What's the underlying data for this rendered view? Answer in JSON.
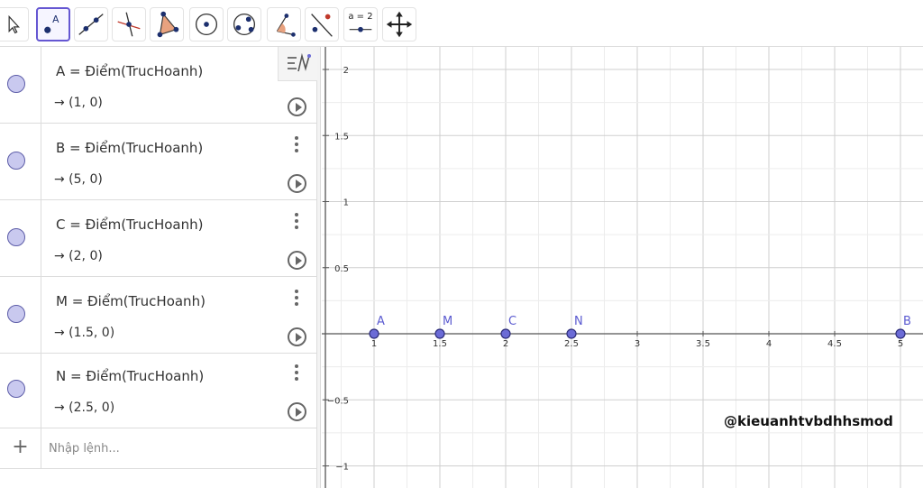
{
  "toolbar": {
    "tools": [
      {
        "name": "move-tool",
        "icon": "cursor-arrow-icon"
      },
      {
        "name": "point-tool",
        "icon": "point-icon",
        "label": "A",
        "active": true
      },
      {
        "name": "line-tool",
        "icon": "line-through-points-icon"
      },
      {
        "name": "perpendicular-line-tool",
        "icon": "perpendicular-line-icon"
      },
      {
        "name": "polygon-tool",
        "icon": "polygon-icon"
      },
      {
        "name": "circle-center-point-tool",
        "icon": "circle-center-icon"
      },
      {
        "name": "circle-three-points-tool",
        "icon": "circle-three-points-icon"
      },
      {
        "name": "angle-tool",
        "icon": "angle-icon"
      },
      {
        "name": "reflect-tool",
        "icon": "reflect-about-line-icon"
      },
      {
        "name": "slider-tool",
        "icon": "slider-icon",
        "label": "a = 2"
      },
      {
        "name": "move-graphics-view-tool",
        "icon": "move-arrows-icon"
      }
    ],
    "accent_color": "#6557d2"
  },
  "algebra": {
    "rows": [
      {
        "definition": "A = Điểm(TrucHoanh)",
        "value": "→ (1, 0)"
      },
      {
        "definition": "B = Điểm(TrucHoanh)",
        "value": "→ (5, 0)"
      },
      {
        "definition": "C = Điểm(TrucHoanh)",
        "value": "→ (2, 0)"
      },
      {
        "definition": "M = Điểm(TrucHoanh)",
        "value": "→ (1.5, 0)"
      },
      {
        "definition": "N = Điểm(TrucHoanh)",
        "value": "→ (2.5, 0)"
      }
    ],
    "input_placeholder": "Nhập lệnh...",
    "point_color": "#c9c9ef"
  },
  "graphics": {
    "x_ticks": [
      "1",
      "1.5",
      "2",
      "2.5",
      "3",
      "3.5",
      "4",
      "4.5",
      "5"
    ],
    "y_ticks": [
      "2",
      "1.5",
      "1",
      "0.5",
      "−0.5",
      "−1"
    ],
    "points": [
      {
        "label": "A",
        "x": 1,
        "y": 0
      },
      {
        "label": "M",
        "x": 1.5,
        "y": 0
      },
      {
        "label": "C",
        "x": 2,
        "y": 0
      },
      {
        "label": "N",
        "x": 2.5,
        "y": 0
      },
      {
        "label": "B",
        "x": 5,
        "y": 0
      }
    ],
    "point_color": "#6b6bd6",
    "grid_color": "#d8d8d8"
  },
  "watermark": "@kieuanhtvbdhhsmod"
}
